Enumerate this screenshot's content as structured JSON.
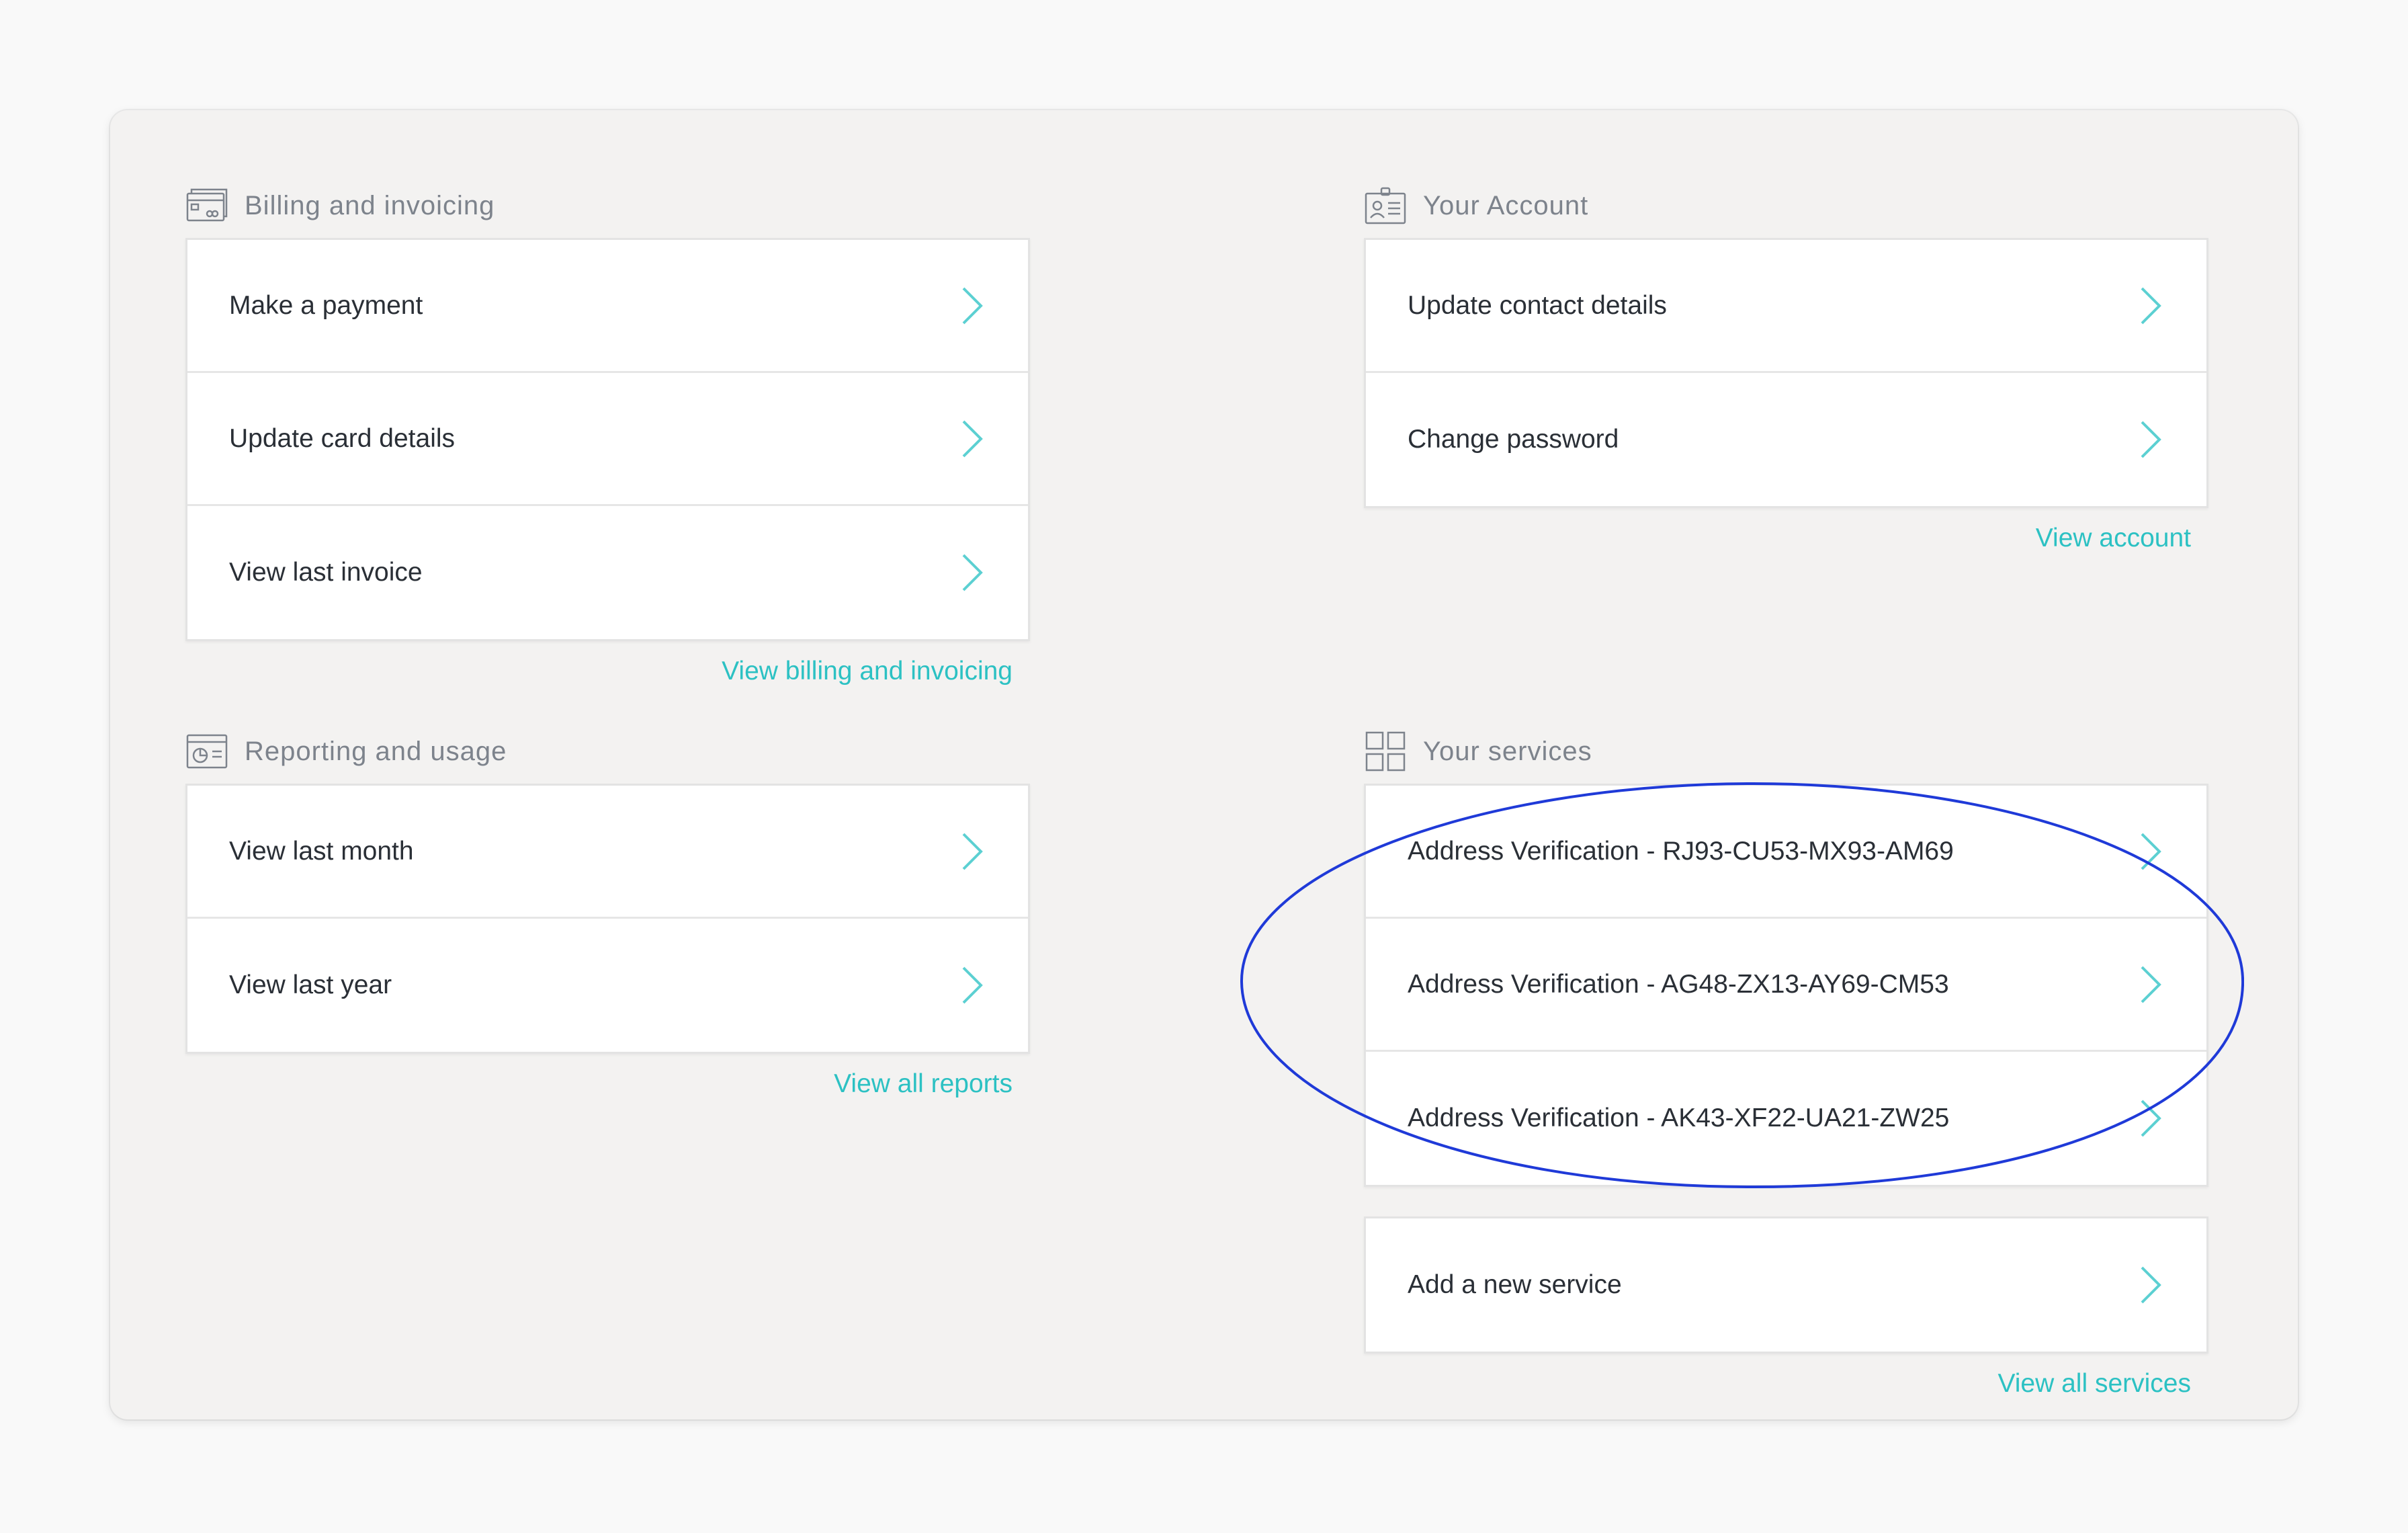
{
  "billing": {
    "title": "Billing and invoicing",
    "items": [
      {
        "label": "Make a payment"
      },
      {
        "label": "Update card details"
      },
      {
        "label": "View last invoice"
      }
    ],
    "link": "View billing and invoicing"
  },
  "account": {
    "title": "Your Account",
    "items": [
      {
        "label": "Update contact details"
      },
      {
        "label": "Change password"
      }
    ],
    "link": "View account"
  },
  "reporting": {
    "title": "Reporting and usage",
    "items": [
      {
        "label": "View last month"
      },
      {
        "label": "View last year"
      }
    ],
    "link": "View all reports"
  },
  "services": {
    "title": "Your services",
    "items": [
      {
        "label": "Address Verification - RJ93-CU53-MX93-AM69"
      },
      {
        "label": "Address Verification - AG48-ZX13-AY69-CM53"
      },
      {
        "label": "Address Verification - AK43-XF22-UA21-ZW25"
      }
    ],
    "add_label": "Add a new service",
    "link": "View all services"
  },
  "icons": {
    "billing": "invoice-card-icon",
    "account": "id-badge-icon",
    "reporting": "chart-window-icon",
    "services": "grid-icon",
    "chevron": "chevron-right-icon"
  },
  "colors": {
    "accent": "#2cc1c3",
    "annotation": "#1f3ad8"
  }
}
